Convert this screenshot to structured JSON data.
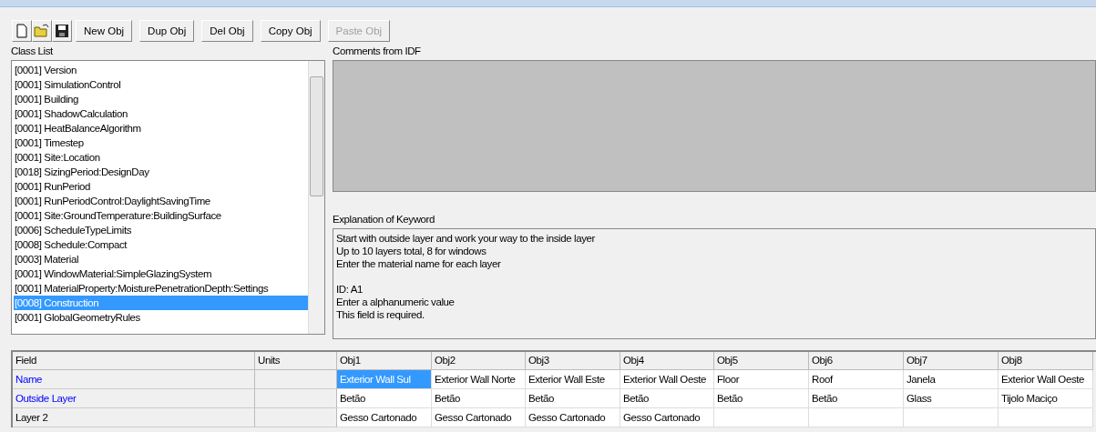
{
  "toolbar": [
    {
      "kind": "icon"
    },
    {
      "kind": "icon"
    },
    {
      "kind": "icon"
    },
    {
      "kind": "text",
      "label": "New Obj",
      "disabled": false
    },
    {
      "kind": "text",
      "label": "Dup Obj",
      "disabled": false
    },
    {
      "kind": "text",
      "label": "Del Obj",
      "disabled": false
    },
    {
      "kind": "text",
      "label": "Copy Obj",
      "disabled": false
    },
    {
      "kind": "text",
      "label": "Paste Obj",
      "disabled": true
    }
  ],
  "class_list": {
    "label": "Class List",
    "items": [
      {
        "label": "[0001]  Version",
        "selected": false
      },
      {
        "label": "[0001]  SimulationControl",
        "selected": false
      },
      {
        "label": "[0001]  Building",
        "selected": false
      },
      {
        "label": "[0001]  ShadowCalculation",
        "selected": false
      },
      {
        "label": "[0001]  HeatBalanceAlgorithm",
        "selected": false
      },
      {
        "label": "[0001]  Timestep",
        "selected": false
      },
      {
        "label": "[0001]  Site:Location",
        "selected": false
      },
      {
        "label": "[0018]  SizingPeriod:DesignDay",
        "selected": false
      },
      {
        "label": "[0001]  RunPeriod",
        "selected": false
      },
      {
        "label": "[0001]  RunPeriodControl:DaylightSavingTime",
        "selected": false
      },
      {
        "label": "[0001]  Site:GroundTemperature:BuildingSurface",
        "selected": false
      },
      {
        "label": "[0006]  ScheduleTypeLimits",
        "selected": false
      },
      {
        "label": "[0008]  Schedule:Compact",
        "selected": false
      },
      {
        "label": "[0003]  Material",
        "selected": false
      },
      {
        "label": "[0001]  WindowMaterial:SimpleGlazingSystem",
        "selected": false
      },
      {
        "label": "[0001]  MaterialProperty:MoisturePenetrationDepth:Settings",
        "selected": false
      },
      {
        "label": "[0008]  Construction",
        "selected": true
      },
      {
        "label": "[0001]  GlobalGeometryRules",
        "selected": false
      }
    ]
  },
  "comments": {
    "label": "Comments from IDF"
  },
  "explanation": {
    "label": "Explanation of Keyword",
    "paragraphs": [
      [
        "Start with outside layer and work your way to the inside layer",
        "Up to 10 layers total, 8 for windows",
        "Enter the material name for each layer"
      ],
      [
        "ID: A1",
        "Enter a alphanumeric value",
        "This field is required."
      ]
    ]
  },
  "grid": {
    "columns": [
      "Field",
      "Units",
      "Obj1",
      "Obj2",
      "Obj3",
      "Obj4",
      "Obj5",
      "Obj6",
      "Obj7",
      "Obj8"
    ],
    "rows": [
      {
        "color": "#0000ff",
        "cells": [
          {
            "text": "Name"
          },
          {
            "text": ""
          },
          {
            "text": "Exterior Wall Sul",
            "selected": true
          },
          {
            "text": "Exterior Wall Norte",
            "selected": false
          },
          {
            "text": "Exterior Wall Este",
            "selected": false
          },
          {
            "text": "Exterior Wall Oeste",
            "selected": false
          },
          {
            "text": "Floor",
            "selected": false
          },
          {
            "text": "Roof",
            "selected": false
          },
          {
            "text": "Janela",
            "selected": false
          },
          {
            "text": "Exterior Wall Oeste",
            "selected": false
          }
        ]
      },
      {
        "color": "#0000ff",
        "cells": [
          {
            "text": "Outside Layer"
          },
          {
            "text": ""
          },
          {
            "text": "Betão",
            "selected": false
          },
          {
            "text": "Betão",
            "selected": false
          },
          {
            "text": "Betão",
            "selected": false
          },
          {
            "text": "Betão",
            "selected": false
          },
          {
            "text": "Betão",
            "selected": false
          },
          {
            "text": "Betão",
            "selected": false
          },
          {
            "text": "Glass",
            "selected": false
          },
          {
            "text": "Tijolo Maciço",
            "selected": false
          }
        ]
      },
      {
        "color": "#000000",
        "cells": [
          {
            "text": "Layer 2"
          },
          {
            "text": ""
          },
          {
            "text": "Gesso Cartonado",
            "selected": false
          },
          {
            "text": "Gesso Cartonado",
            "selected": false
          },
          {
            "text": "Gesso Cartonado",
            "selected": false
          },
          {
            "text": "Gesso Cartonado",
            "selected": false
          },
          {
            "text": "",
            "selected": false
          },
          {
            "text": "",
            "selected": false
          },
          {
            "text": "",
            "selected": false
          },
          {
            "text": "",
            "selected": false
          }
        ]
      }
    ]
  }
}
